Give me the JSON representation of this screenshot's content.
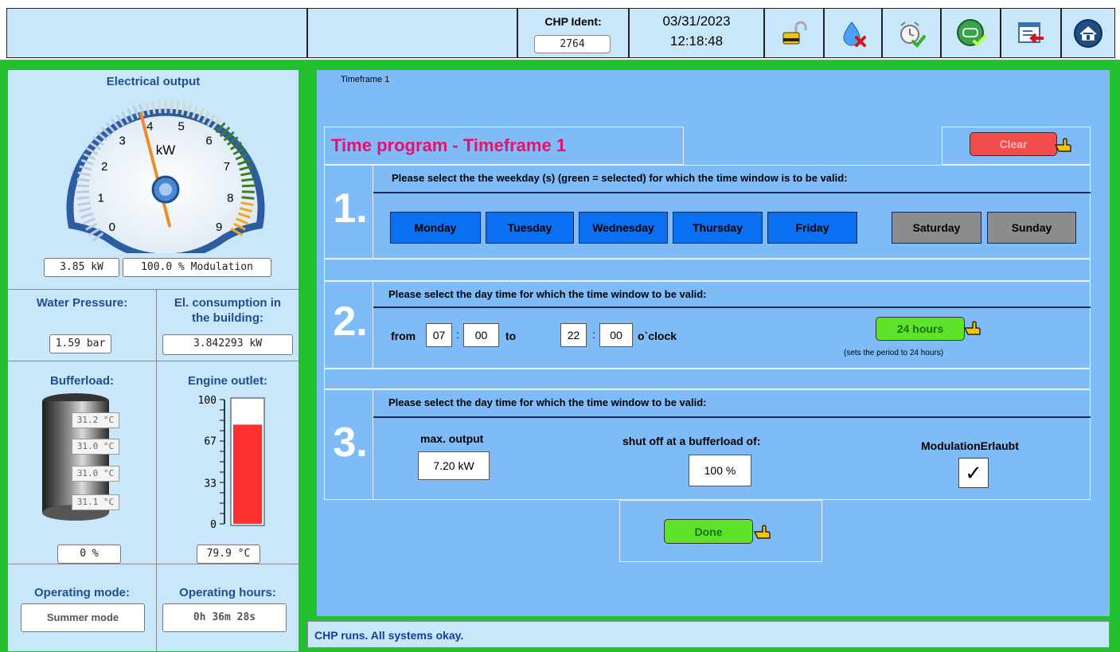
{
  "header": {
    "chp_ident_label": "CHP Ident:",
    "chp_ident_value": "2764",
    "date": "03/31/2023",
    "time": "12:18:48",
    "icons": [
      "unlock-icon",
      "water-error-icon",
      "alarm-clock-check-icon",
      "chp-ok-icon",
      "window-exit-icon",
      "home-icon"
    ]
  },
  "left": {
    "electrical_output": {
      "title": "Electrical output",
      "gauge_unit": "kW",
      "gauge_ticks": [
        "0",
        "1",
        "2",
        "3",
        "4",
        "5",
        "6",
        "7",
        "8",
        "9"
      ],
      "value": 3.85,
      "power_text": "3.85 kW",
      "modulation_text": "100.0 % Modulation"
    },
    "water_pressure": {
      "title": "Water Pressure:",
      "value": "1.59 bar"
    },
    "el_consumption": {
      "title_line1": "El. consumption in",
      "title_line2": "the building:",
      "value": "3.842293 kW"
    },
    "bufferload": {
      "title": "Bufferload:",
      "temps": [
        "31.2 °C",
        "31.0 °C",
        "31.0 °C",
        "31.1 °C"
      ],
      "value": "0 %"
    },
    "engine_outlet": {
      "title": "Engine outlet:",
      "ticks": [
        "100",
        "67",
        "33",
        "0"
      ],
      "fill_fraction": 0.799,
      "value": "79.9 °C"
    },
    "operating_mode": {
      "title": "Operating mode:",
      "value": "Summer mode"
    },
    "operating_hours": {
      "title": "Operating hours:",
      "value": "0h 36m 28s"
    }
  },
  "main": {
    "frame_label": "Timeframe 1",
    "title": "Time program - Timeframe 1",
    "clear_label": "Clear",
    "step1": {
      "number": "1.",
      "text": "Please select the the weekday (s) (green = selected) for which the time window is to be valid:",
      "days": [
        {
          "label": "Monday",
          "state": "on"
        },
        {
          "label": "Tuesday",
          "state": "on"
        },
        {
          "label": "Wednesday",
          "state": "on"
        },
        {
          "label": "Thursday",
          "state": "on"
        },
        {
          "label": "Friday",
          "state": "on"
        },
        {
          "label": "Saturday",
          "state": "off"
        },
        {
          "label": "Sunday",
          "state": "off"
        }
      ]
    },
    "step2": {
      "number": "2.",
      "text": "Please select the day time for which the time window to be valid:",
      "from_label": "from",
      "from_hour": "07",
      "from_min": "00",
      "to_label": "to",
      "to_hour": "22",
      "to_min": "00",
      "oclock_label": "o`clock",
      "hours_button": "24 hours",
      "hours_note": "(sets the period to 24 hours)",
      "colon": ":"
    },
    "step3": {
      "number": "3.",
      "text": "Please select the day time for which the time window to be valid:",
      "max_output_label": "max. output",
      "max_output_value": "7.20 kW",
      "shutoff_label": "shut off at a bufferload of:",
      "shutoff_value": "100 %",
      "modulation_label": "ModulationErlaubt",
      "modulation_checked": true,
      "check_mark": "✓"
    },
    "done_label": "Done"
  },
  "status": {
    "text": "CHP runs. All systems okay."
  },
  "colors": {
    "frame_green": "#23c12e",
    "panel_blue": "#7fbcf7",
    "light_blue": "#c9e7fb",
    "title_pink": "#e8106a",
    "day_selected": "#0a6ff0",
    "day_unselected": "#8c8c8c",
    "clear_red": "#f24b4b",
    "button_green": "#5ee32a"
  }
}
